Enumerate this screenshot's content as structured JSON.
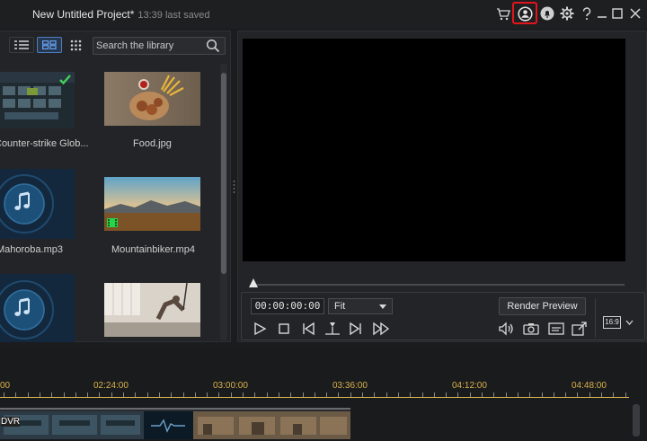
{
  "titlebar": {
    "project_name": "New Untitled Project*",
    "saved_status": "13:39 last saved",
    "icons": [
      "cart-icon",
      "account-icon",
      "notification-icon",
      "settings-icon",
      "help-icon",
      "minimize-icon",
      "maximize-icon",
      "close-icon"
    ],
    "highlight_color": "#e3141c"
  },
  "library": {
    "search_placeholder": "Search the library",
    "items": [
      {
        "label": "Counter-strike  Glob...",
        "kind": "video",
        "checked": true
      },
      {
        "label": "Food.jpg",
        "kind": "image"
      },
      {
        "label": "Mahoroba.mp3",
        "kind": "audio"
      },
      {
        "label": "Mountainbiker.mp4",
        "kind": "video"
      },
      {
        "label": "",
        "kind": "audio"
      },
      {
        "label": "",
        "kind": "image"
      }
    ]
  },
  "preview": {
    "timecode": "00:00:00:00",
    "zoom": "Fit",
    "render_label": "Render Preview",
    "aspect_ratio": "16:9"
  },
  "timeline": {
    "ruler": [
      "00",
      "02:24:00",
      "03:00:00",
      "03:36:00",
      "04:12:00",
      "04:48:00"
    ],
    "clip_label": "DVR",
    "accent": "#d8b24a"
  }
}
